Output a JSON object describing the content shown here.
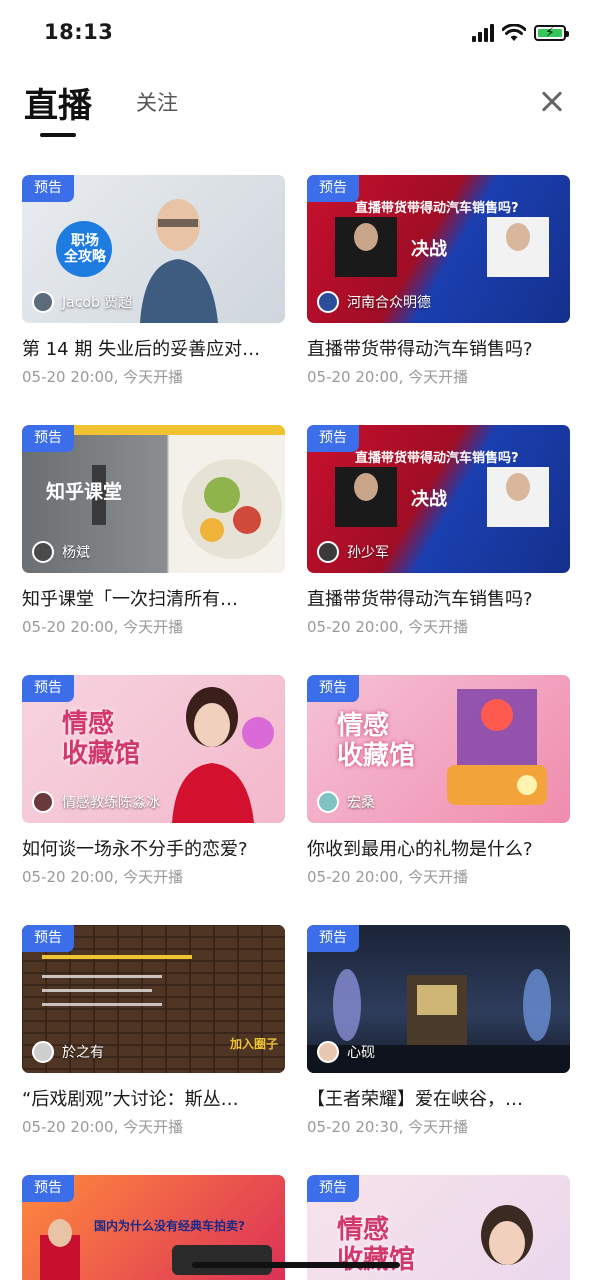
{
  "status_bar": {
    "time": "18:13"
  },
  "header": {
    "tab_live": "直播",
    "tab_follow": "关注"
  },
  "badge_label": "预告",
  "cards": [
    {
      "title": "第 14 期 失业后的妥善应对…",
      "meta": "05-20 20:00, 今天开播",
      "host": "Jacob 贾超",
      "overlay": "职场 全攻略"
    },
    {
      "title": "直播带货带得动汽车销售吗?",
      "meta": "05-20 20:00, 今天开播",
      "host": "河南合众明德",
      "overlay": "直播带货带得动汽车销售吗?"
    },
    {
      "title": "知乎课堂「一次扫清所有…",
      "meta": "05-20 20:00, 今天开播",
      "host": "杨斌",
      "overlay": "知乎课堂"
    },
    {
      "title": "直播带货带得动汽车销售吗?",
      "meta": "05-20 20:00, 今天开播",
      "host": "孙少军",
      "overlay": "直播带货带得动汽车销售吗?"
    },
    {
      "title": "如何谈一场永不分手的恋爱?",
      "meta": "05-20 20:00, 今天开播",
      "host": "情感教练陈淼冰",
      "overlay": "情感 收藏馆"
    },
    {
      "title": "你收到最用心的礼物是什么?",
      "meta": "05-20 20:00, 今天开播",
      "host": "宏桑",
      "overlay": "情感 收藏馆"
    },
    {
      "title": "“后戏剧观”大讨论：斯丛…",
      "meta": "05-20 20:00, 今天开播",
      "host": "於之有",
      "overlay": "加入圈子"
    },
    {
      "title": "【王者荣耀】爱在峡谷，…",
      "meta": "05-20 20:30, 今天开播",
      "host": "心砚",
      "overlay": ""
    },
    {
      "title": "",
      "meta": "",
      "host": "",
      "overlay": "国内为什么没有经典车拍卖?"
    },
    {
      "title": "",
      "meta": "",
      "host": "",
      "overlay": "情感 收藏馆"
    }
  ],
  "colors": {
    "badge": "#3b6ee8",
    "meta_text": "#9a9a9a",
    "battery": "#35c759"
  }
}
